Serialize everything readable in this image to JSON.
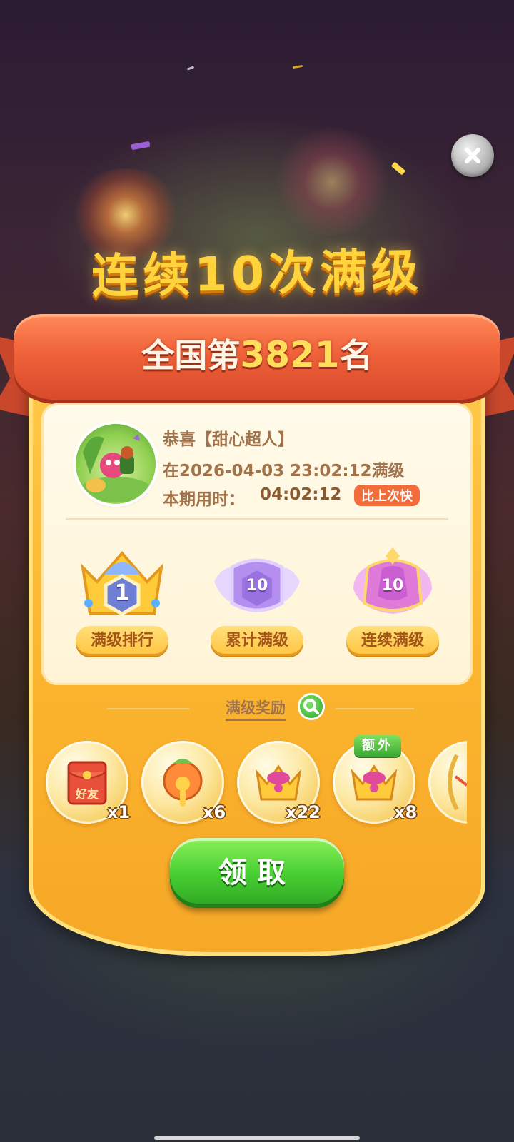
{
  "header": {
    "title": "连续10次满级"
  },
  "rank": {
    "prefix": "全国第",
    "number": "3821",
    "suffix": "名"
  },
  "player": {
    "congrats": "恭喜【甜心超人】",
    "time_line": "在2026-04-03 23:02:12满级",
    "duration_label": "本期用时：",
    "duration_value": "04:02:12",
    "compare_badge": "比上次快"
  },
  "badges": [
    {
      "label": "满级排行",
      "value": "1"
    },
    {
      "label": "累计满级",
      "value": "10"
    },
    {
      "label": "连续满级",
      "value": "10"
    }
  ],
  "rewards": {
    "title": "满级奖励",
    "extra_tag": "额外",
    "items": [
      {
        "icon": "red-envelope-icon",
        "icon_text": "好友",
        "count": "x1"
      },
      {
        "icon": "magic-wand-icon",
        "count": "x6"
      },
      {
        "icon": "crown-icon",
        "count": "x22"
      },
      {
        "icon": "crown-icon",
        "count": "x8"
      }
    ]
  },
  "claim_button": {
    "label": "领取"
  },
  "colors": {
    "panel": "#fbb42e",
    "ribbon": "#f0623a",
    "button": "#4ad034"
  }
}
